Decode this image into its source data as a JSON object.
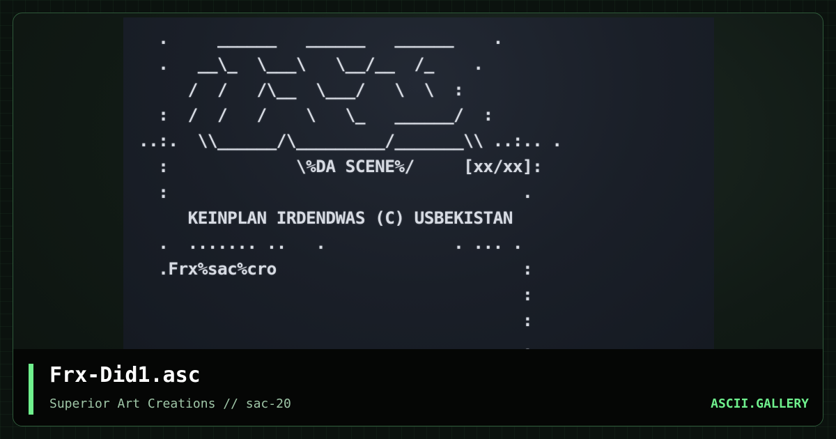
{
  "artwork": {
    "lines": [
      "  .     ______   ______   ______    .",
      "  .   __\\_  \\___\\   \\__/__  /_    .",
      "     /  /   /\\__  \\___/   \\  \\  :",
      "  :  /  /   /    \\   \\_   ______/  :",
      "..:.  \\\\______/\\_________/_______\\\\ ..:.. .",
      "  :             \\%DA SCENE%/     [xx/xx]:",
      "  :                                    .",
      "     KEINPLAN IRDENDWAS (C) USBEKISTAN",
      "  .  ....... ..   .             . ... .",
      "  .Frx%sac%cro                         :",
      "                                       :",
      "                                       :",
      "                                       ."
    ]
  },
  "footer": {
    "title": "Frx-Did1.asc",
    "subtitle": "Superior Art Creations // sac-20",
    "brand": "ASCII.GALLERY"
  },
  "colors": {
    "accent": "#6ff08d",
    "background": "#0b120e",
    "art_panel": "#1a1f28",
    "art_text": "#d7dbe3"
  }
}
